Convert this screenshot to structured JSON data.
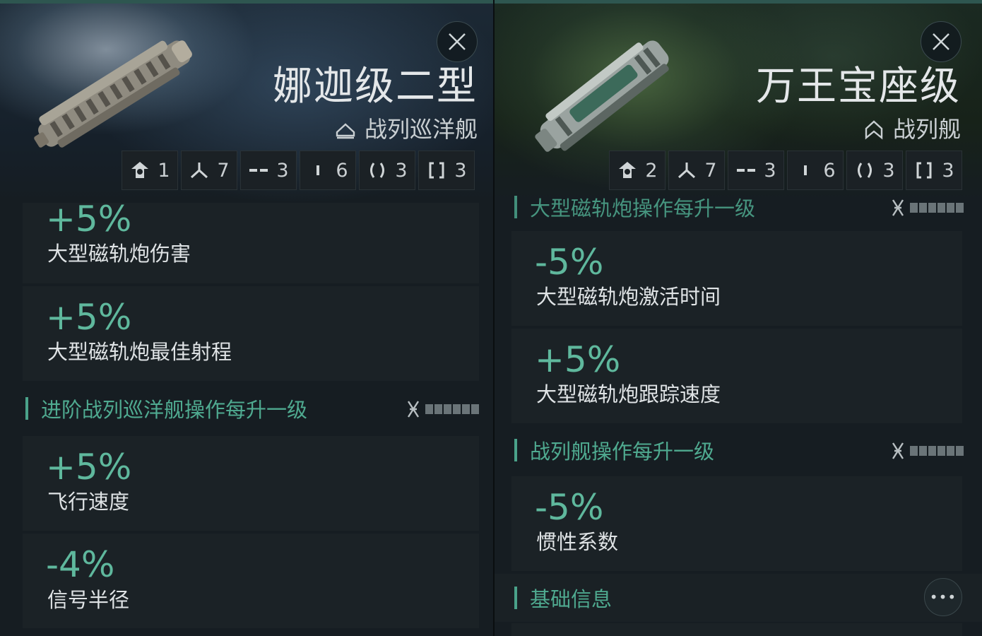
{
  "left": {
    "ship_name": "娜迦级二型",
    "ship_class": "战列巡洋舰",
    "slots": [
      {
        "icon": "drone-bay-icon",
        "value": "1"
      },
      {
        "icon": "turret-hardpoint-icon",
        "value": "7"
      },
      {
        "icon": "high-slot-icon",
        "value": "3"
      },
      {
        "icon": "mid-slot-icon",
        "value": "6"
      },
      {
        "icon": "low-slot-icon",
        "value": "3"
      },
      {
        "icon": "rig-slot-icon",
        "value": "3"
      }
    ],
    "bonuses_top": [
      {
        "value": "+5%",
        "label": "大型磁轨炮伤害"
      },
      {
        "value": "+5%",
        "label": "大型磁轨炮最佳射程"
      }
    ],
    "section": {
      "title": "进阶战列巡洋舰操作每升一级",
      "icon": "skill-dna-icon"
    },
    "bonuses_bottom": [
      {
        "value": "+5%",
        "label": "飞行速度"
      },
      {
        "value": "-4%",
        "label": "信号半径"
      }
    ]
  },
  "right": {
    "ship_name": "万王宝座级",
    "ship_class": "战列舰",
    "slots": [
      {
        "icon": "drone-bay-icon",
        "value": "2"
      },
      {
        "icon": "turret-hardpoint-icon",
        "value": "7"
      },
      {
        "icon": "high-slot-icon",
        "value": "3"
      },
      {
        "icon": "mid-slot-icon",
        "value": "6"
      },
      {
        "icon": "low-slot-icon",
        "value": "3"
      },
      {
        "icon": "rig-slot-icon",
        "value": "3"
      }
    ],
    "section_partial": {
      "title": "大型磁轨炮操作每升一级",
      "icon": "skill-dna-icon"
    },
    "bonuses_top": [
      {
        "value": "-5%",
        "label": "大型磁轨炮激活时间"
      },
      {
        "value": "+5%",
        "label": "大型磁轨炮跟踪速度"
      }
    ],
    "section": {
      "title": "战列舰操作每升一级",
      "icon": "skill-dna-icon"
    },
    "bonuses_bottom": [
      {
        "value": "-5%",
        "label": "惯性系数"
      }
    ],
    "info_section": {
      "title": "基础信息",
      "more_label": "•••"
    }
  },
  "colors": {
    "accent": "#5fb89d",
    "panel": "#161d22",
    "card": "#1b2226"
  }
}
